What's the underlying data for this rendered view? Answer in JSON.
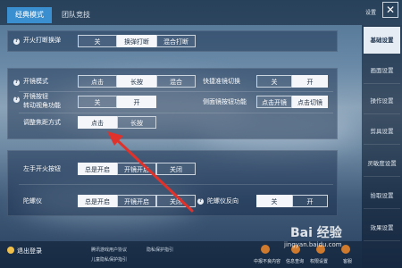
{
  "tabs": [
    {
      "label": "经典模式",
      "active": true
    },
    {
      "label": "团队竞技",
      "active": false
    }
  ],
  "header": {
    "settings_label": "设置",
    "close_glyph": "✕"
  },
  "sidebar": {
    "items": [
      {
        "label": "基础设置",
        "active": true
      },
      {
        "label": "画面设置",
        "active": false
      },
      {
        "label": "操作设置",
        "active": false
      },
      {
        "label": "剪具设置",
        "active": false
      },
      {
        "label": "灵敏度设置",
        "active": false
      },
      {
        "label": "拾取设置",
        "active": false
      },
      {
        "label": "效果设置",
        "active": false
      }
    ]
  },
  "section_top": {
    "label": "开火打断换弹",
    "options": [
      "关",
      "换弹打断",
      "混合打断"
    ],
    "selected": 1
  },
  "section_scope": {
    "open_mode": {
      "label": "开镜模式",
      "options": [
        "点击",
        "长按",
        "混合"
      ],
      "selected": 1
    },
    "quick_scope": {
      "label": "快捷准镜切换",
      "options": [
        "关",
        "开"
      ],
      "selected": 1
    },
    "rotate_view": {
      "label": [
        "开镜按钮",
        "转动视角功能"
      ],
      "options": [
        "关",
        "开"
      ],
      "selected": 1
    },
    "side_scope": {
      "label": "侧面镜按钮功能",
      "options": [
        "点击开镜",
        "点击切镜"
      ],
      "selected": 1
    },
    "focus_mode": {
      "label": "调整焦距方式",
      "options": [
        "点击",
        "长按"
      ],
      "selected": 0
    }
  },
  "section_fire": {
    "left_fire": {
      "label": "左手开火按钮",
      "options": [
        "总是开启",
        "开镜开启",
        "关闭"
      ],
      "selected": 0
    },
    "gyro": {
      "label": "陀螺仪",
      "options": [
        "总是开启",
        "开镜开启",
        "关闭"
      ],
      "selected": 0
    },
    "gyro_reverse": {
      "label": "陀螺仪反向",
      "options": [
        "关",
        "开"
      ],
      "selected": 0
    }
  },
  "bottom": {
    "logout_label": "退出登录",
    "links": [
      "腾讯游戏用户协议",
      "隐私保护指引",
      "儿童隐私保护指引"
    ],
    "icons": [
      {
        "name": "parent-guard",
        "label": "中报不良内容"
      },
      {
        "name": "info-query",
        "label": "信息查询"
      },
      {
        "name": "permission",
        "label": "权限设置"
      },
      {
        "name": "service",
        "label": "客服"
      }
    ]
  },
  "watermark": {
    "line1": "Bai 经验",
    "line2": "jingyan.baidu.com"
  },
  "colors": {
    "accent": "#3a8fd0",
    "selected_bg": "#f4f6f9",
    "arrow": "#e0322a"
  }
}
